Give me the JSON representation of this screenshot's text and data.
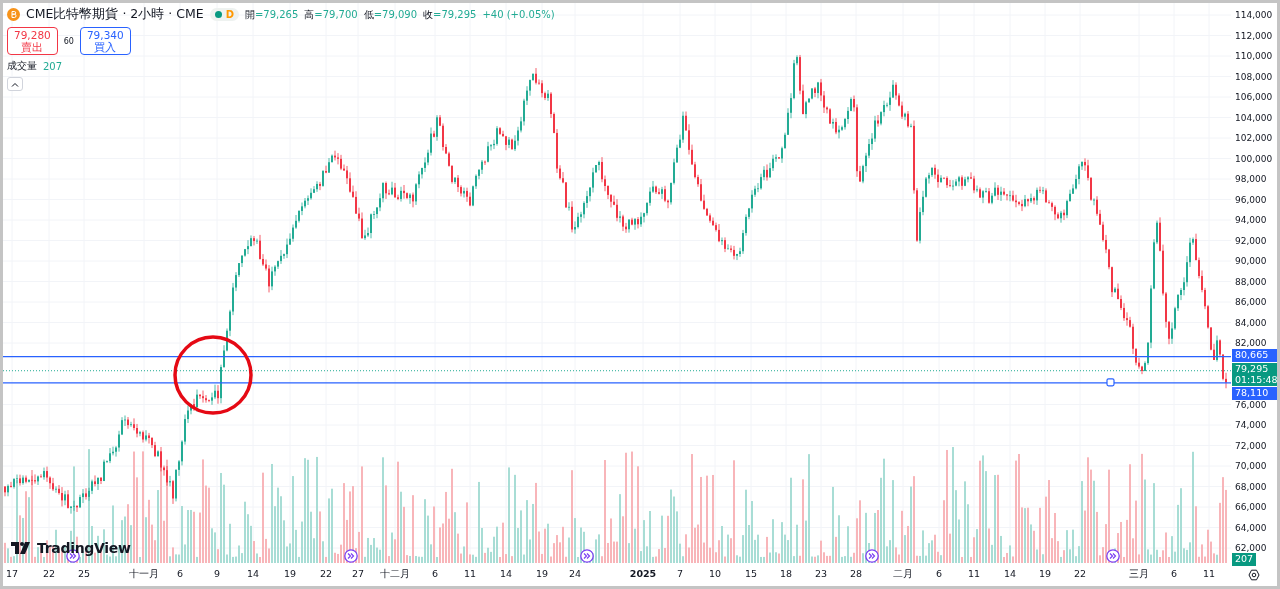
{
  "header": {
    "title": "CME比特幣期貨 · 2小時 · CME",
    "badge": "D",
    "ohlc": [
      {
        "label": "開",
        "value": "=79,265"
      },
      {
        "label": "高",
        "value": "=79,700"
      },
      {
        "label": "低",
        "value": "=79,090"
      },
      {
        "label": "收",
        "value": "=79,295"
      }
    ],
    "change": "+40 (+0.05%)"
  },
  "trade": {
    "sell": {
      "price": "79,280",
      "label": "賣出"
    },
    "spread": "60",
    "buy": {
      "price": "79,340",
      "label": "買入"
    }
  },
  "volume_legend": {
    "label": "成交量",
    "value": "207"
  },
  "logo": "TradingView",
  "price_axis": {
    "ticks": [
      "114,000",
      "112,000",
      "110,000",
      "108,000",
      "106,000",
      "104,000",
      "102,000",
      "100,000",
      "98,000",
      "96,000",
      "94,000",
      "92,000",
      "90,000",
      "88,000",
      "86,000",
      "84,000",
      "82,000",
      "76,000",
      "74,000",
      "72,000",
      "70,000",
      "68,000",
      "66,000",
      "64,000",
      "62,000"
    ],
    "tags": [
      {
        "kind": "line",
        "text": "80,665"
      },
      {
        "kind": "last",
        "text": "79,295",
        "countdown": "01:15:48"
      },
      {
        "kind": "line",
        "text": "78,110"
      },
      {
        "kind": "volume",
        "text": "207"
      }
    ]
  },
  "time_axis": {
    "labels": [
      {
        "kind": "day",
        "text": "17"
      },
      {
        "kind": "day",
        "text": "22"
      },
      {
        "kind": "day",
        "text": "25"
      },
      {
        "kind": "month",
        "text": "十一月"
      },
      {
        "kind": "day",
        "text": "6"
      },
      {
        "kind": "day",
        "text": "9"
      },
      {
        "kind": "day",
        "text": "14"
      },
      {
        "kind": "day",
        "text": "19"
      },
      {
        "kind": "day",
        "text": "22"
      },
      {
        "kind": "day",
        "text": "27"
      },
      {
        "kind": "month",
        "text": "十二月"
      },
      {
        "kind": "day",
        "text": "6"
      },
      {
        "kind": "day",
        "text": "11"
      },
      {
        "kind": "day",
        "text": "14"
      },
      {
        "kind": "day",
        "text": "19"
      },
      {
        "kind": "day",
        "text": "24"
      },
      {
        "kind": "year",
        "text": "2025"
      },
      {
        "kind": "day",
        "text": "7"
      },
      {
        "kind": "day",
        "text": "10"
      },
      {
        "kind": "day",
        "text": "15"
      },
      {
        "kind": "day",
        "text": "18"
      },
      {
        "kind": "day",
        "text": "23"
      },
      {
        "kind": "day",
        "text": "28"
      },
      {
        "kind": "month",
        "text": "二月"
      },
      {
        "kind": "day",
        "text": "6"
      },
      {
        "kind": "day",
        "text": "11"
      },
      {
        "kind": "day",
        "text": "14"
      },
      {
        "kind": "day",
        "text": "19"
      },
      {
        "kind": "day",
        "text": "22"
      },
      {
        "kind": "month",
        "text": "三月"
      },
      {
        "kind": "day",
        "text": "6"
      },
      {
        "kind": "day",
        "text": "11"
      }
    ]
  }
}
